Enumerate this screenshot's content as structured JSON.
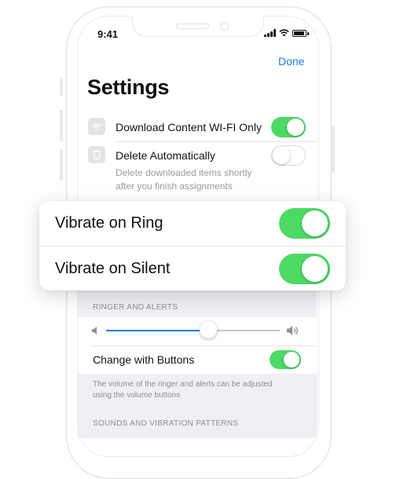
{
  "status_bar": {
    "time": "9:41"
  },
  "nav": {
    "done_label": "Done"
  },
  "page": {
    "title": "Settings"
  },
  "settings_rows": [
    {
      "label": "Download Content WI-FI Only",
      "icon": "wifi-icon",
      "enabled": true
    },
    {
      "label": "Delete Automatically",
      "icon": "trash-icon",
      "enabled": false,
      "note": [
        "Delete downloaded items shortly",
        "after you finish assignments"
      ]
    }
  ],
  "card": {
    "rows": [
      {
        "label": "Vibrate on Ring",
        "enabled": true
      },
      {
        "label": "Vibrate on Silent",
        "enabled": true
      }
    ]
  },
  "ringer": {
    "header": "RINGER AND ALERTS",
    "volume_level": 0.59,
    "change_with_buttons_label": "Change with Buttons",
    "change_with_buttons_enabled": true,
    "footer": [
      "The volume of the ringer and alerts can be adjusted",
      "using the volume buttons"
    ]
  },
  "sounds": {
    "header": "SOUNDS AND VIBRATION PATTERNS"
  },
  "colors": {
    "accent": "#1b7cf2",
    "toggle_on": "#4cd964",
    "grouped_bg": "#efeff4"
  }
}
